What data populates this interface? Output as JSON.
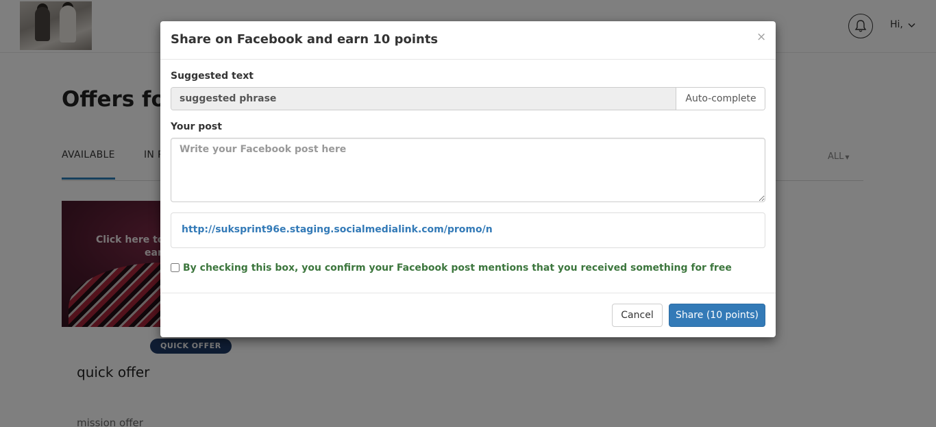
{
  "header": {
    "greeting": "Hi,"
  },
  "page": {
    "title": "Offers for",
    "tabs": [
      {
        "label": "AVAILABLE",
        "active": true
      },
      {
        "label": "IN P"
      }
    ],
    "filter_label": "ALL",
    "accent_color": "#2c7fb8"
  },
  "card": {
    "overlay_text_line1": "Click here to sh",
    "overlay_text_line2": "ear",
    "badge": "QUICK OFFER",
    "title": "quick offer",
    "description": "mission offer"
  },
  "modal": {
    "title": "Share on Facebook and earn 10 points",
    "close_label": "×",
    "suggested_text_label": "Suggested text",
    "suggested_phrase": "suggested phrase",
    "autocomplete_label": "Auto-complete",
    "your_post_label": "Your post",
    "post_placeholder": "Write your Facebook post here",
    "post_value": "",
    "link": "http://suksprint96e.staging.socialmedialink.com/promo/n",
    "consent_label": "By checking this box, you confirm your Facebook post mentions that you received something for free",
    "consent_checked": false,
    "cancel_label": "Cancel",
    "share_label": "Share (10 points)",
    "primary_color": "#337ab7",
    "consent_color": "#3c763d"
  },
  "icons": {
    "notification": "bell-icon",
    "user_menu": "chevron-down-icon",
    "filter": "caret-down-icon",
    "close": "close-icon"
  }
}
